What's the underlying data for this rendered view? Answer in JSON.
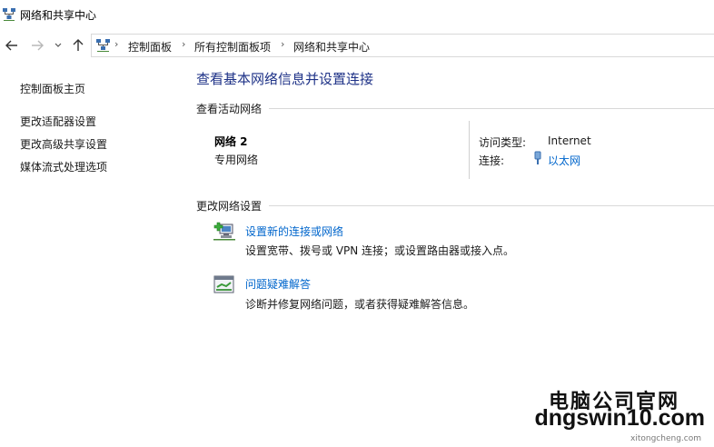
{
  "window": {
    "title": "网络和共享中心"
  },
  "nav": {
    "back_icon": "arrow-left-icon",
    "forward_icon": "arrow-right-icon",
    "recent_icon": "chevron-down-icon",
    "up_icon": "arrow-up-icon"
  },
  "address": {
    "breadcrumbs": [
      "控制面板",
      "所有控制面板项",
      "网络和共享中心"
    ]
  },
  "left_pane": {
    "links": [
      "控制面板主页",
      "更改适配器设置",
      "更改高级共享设置",
      "媒体流式处理选项"
    ]
  },
  "main": {
    "title": "查看基本网络信息并设置连接",
    "active_networks_header": "查看活动网络",
    "network": {
      "name": "网络 2",
      "type": "专用网络",
      "access_type_label": "访问类型:",
      "access_type_value": "Internet",
      "connection_label": "连接:",
      "connection_value": "以太网"
    },
    "change_settings_header": "更改网络设置",
    "tasks": [
      {
        "icon": "new-connection-icon",
        "link": "设置新的连接或网络",
        "desc": "设置宽带、拨号或 VPN 连接；或设置路由器或接入点。"
      },
      {
        "icon": "troubleshoot-icon",
        "link": "问题疑难解答",
        "desc": "诊断并修复网络问题，或者获得疑难解答信息。"
      }
    ]
  },
  "watermark": {
    "line1": "电脑公司官网",
    "line2": "dngswin10.com",
    "line3": "xitongcheng.com"
  },
  "colors": {
    "link": "#0066cc",
    "title": "#1e3287"
  }
}
